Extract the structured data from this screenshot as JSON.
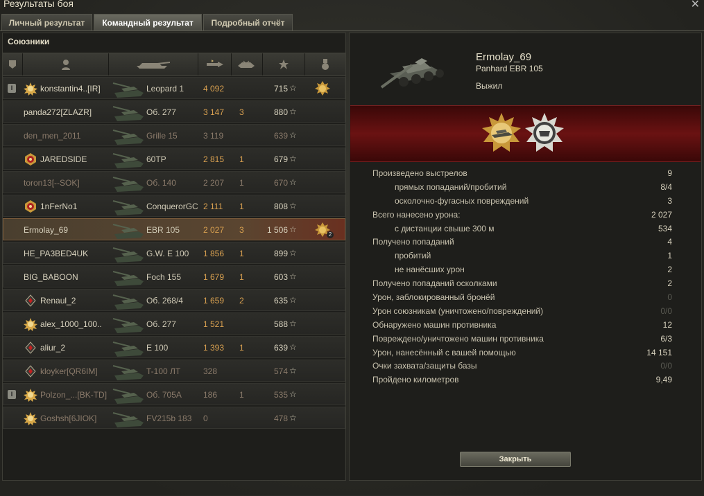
{
  "window": {
    "title": "Результаты боя"
  },
  "tabs": [
    {
      "label": "Личный результат",
      "active": false
    },
    {
      "label": "Командный результат",
      "active": true
    },
    {
      "label": "Подробный отчёт",
      "active": false
    }
  ],
  "allies": {
    "title": "Союзники",
    "columns": [
      "platoon-icon",
      "player-icon",
      "vehicle-icon",
      "damage-icon",
      "kills-icon",
      "xp-icon",
      "medal-icon"
    ],
    "rows": [
      {
        "name": "konstantin4..[IR]",
        "tank": "Leopard 1",
        "damage": "4 092",
        "kills": "",
        "xp": "715",
        "rank": "gold-star",
        "platoon": true,
        "medal": true,
        "dead": false,
        "selected": false
      },
      {
        "name": "panda272[ZLAZR]",
        "tank": "Об. 277",
        "damage": "3 147",
        "kills": "3",
        "xp": "880",
        "rank": "",
        "platoon": false,
        "medal": false,
        "dead": false,
        "selected": false
      },
      {
        "name": "den_men_2011",
        "tank": "Grille 15",
        "damage": "3 119",
        "kills": "",
        "xp": "639",
        "rank": "",
        "platoon": false,
        "medal": false,
        "dead": true,
        "selected": false
      },
      {
        "name": "JAREDSIDE",
        "tank": "60TP",
        "damage": "2 815",
        "kills": "1",
        "xp": "679",
        "rank": "red-badge",
        "platoon": false,
        "medal": false,
        "dead": false,
        "selected": false
      },
      {
        "name": "toron13[--SOK]",
        "tank": "Об. 140",
        "damage": "2 207",
        "kills": "1",
        "xp": "670",
        "rank": "",
        "platoon": false,
        "medal": false,
        "dead": true,
        "selected": false
      },
      {
        "name": "1nFerNo1",
        "tank": "ConquerorGC",
        "damage": "2 111",
        "kills": "1",
        "xp": "808",
        "rank": "red-badge",
        "platoon": false,
        "medal": false,
        "dead": false,
        "selected": false
      },
      {
        "name": "Ermolay_69",
        "tank": "EBR 105",
        "damage": "2 027",
        "kills": "3",
        "xp": "1 506",
        "rank": "",
        "platoon": false,
        "medal": true,
        "dead": false,
        "selected": true
      },
      {
        "name": "HE_PA3BED4UK",
        "tank": "G.W. E 100",
        "damage": "1 856",
        "kills": "1",
        "xp": "899",
        "rank": "",
        "platoon": false,
        "medal": false,
        "dead": false,
        "selected": false
      },
      {
        "name": "BIG_BABOON",
        "tank": "Foch 155",
        "damage": "1 679",
        "kills": "1",
        "xp": "603",
        "rank": "",
        "platoon": false,
        "medal": false,
        "dead": false,
        "selected": false
      },
      {
        "name": "Renaul_2",
        "tank": "Об. 268/4",
        "damage": "1 659",
        "kills": "2",
        "xp": "635",
        "rank": "red-diamond",
        "platoon": false,
        "medal": false,
        "dead": false,
        "selected": false
      },
      {
        "name": "alex_1000_100..",
        "tank": "Об. 277",
        "damage": "1 521",
        "kills": "",
        "xp": "588",
        "rank": "gold-star",
        "platoon": false,
        "medal": false,
        "dead": false,
        "selected": false
      },
      {
        "name": "aliur_2",
        "tank": "E 100",
        "damage": "1 393",
        "kills": "1",
        "xp": "639",
        "rank": "red-diamond",
        "platoon": false,
        "medal": false,
        "dead": false,
        "selected": false
      },
      {
        "name": "kloyker[QR6IM]",
        "tank": "T-100 ЛТ",
        "damage": "328",
        "kills": "",
        "xp": "574",
        "rank": "red-diamond",
        "platoon": false,
        "medal": false,
        "dead": true,
        "selected": false
      },
      {
        "name": "Polzon_...[BK-TD]",
        "tank": "Об. 705А",
        "damage": "186",
        "kills": "1",
        "xp": "535",
        "rank": "gold-star",
        "platoon": true,
        "medal": false,
        "dead": true,
        "selected": false
      },
      {
        "name": "Goshsh[6JIOK]",
        "tank": "FV215b 183",
        "damage": "0",
        "kills": "",
        "xp": "478",
        "rank": "gold-star",
        "platoon": false,
        "medal": false,
        "dead": true,
        "selected": false
      }
    ]
  },
  "detail": {
    "player": "Ermolay_69",
    "vehicle": "Panhard EBR 105",
    "status": "Выжил",
    "stats": [
      {
        "label": "Произведено выстрелов",
        "value": "9",
        "sub": false,
        "dim": false
      },
      {
        "label": "прямых попаданий/пробитий",
        "value": "8/4",
        "sub": true,
        "dim": false
      },
      {
        "label": "осколочно-фугасных повреждений",
        "value": "3",
        "sub": true,
        "dim": false
      },
      {
        "label": "Всего нанесено урона:",
        "value": "2 027",
        "sub": false,
        "dim": false
      },
      {
        "label": "с дистанции свыше 300 м",
        "value": "534",
        "sub": true,
        "dim": false
      },
      {
        "label": "Получено попаданий",
        "value": "4",
        "sub": false,
        "dim": false
      },
      {
        "label": "пробитий",
        "value": "1",
        "sub": true,
        "dim": false
      },
      {
        "label": "не нанёсших урон",
        "value": "2",
        "sub": true,
        "dim": false
      },
      {
        "label": "Получено попаданий осколками",
        "value": "2",
        "sub": false,
        "dim": false
      },
      {
        "label": "Урон, заблокированный бронёй",
        "value": "0",
        "sub": false,
        "dim": true
      },
      {
        "label": "Урон союзникам (уничтожено/повреждений)",
        "value": "0/0",
        "sub": false,
        "dim": true
      },
      {
        "label": "Обнаружено машин противника",
        "value": "12",
        "sub": false,
        "dim": false
      },
      {
        "label": "Повреждено/уничтожено машин противника",
        "value": "6/3",
        "sub": false,
        "dim": false
      },
      {
        "label": "Урон, нанесённый с вашей помощью",
        "value": "14 151",
        "sub": false,
        "dim": false
      },
      {
        "label": "Очки захвата/защиты базы",
        "value": "0/0",
        "sub": false,
        "dim": true
      },
      {
        "label": "Пройдено километров",
        "value": "9,49",
        "sub": false,
        "dim": false
      }
    ],
    "medal_count": "2"
  },
  "close_button": "Закрыть",
  "colors": {
    "selected_row": "#5a4530",
    "award_band": "#6a1212",
    "damage": "#d8a050"
  }
}
